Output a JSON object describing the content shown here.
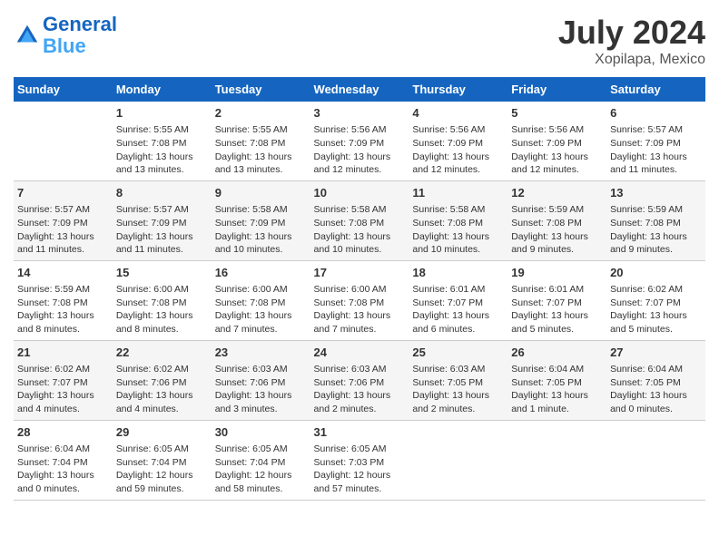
{
  "header": {
    "logo_line1": "General",
    "logo_line2": "Blue",
    "title": "July 2024",
    "subtitle": "Xopilapa, Mexico"
  },
  "columns": [
    "Sunday",
    "Monday",
    "Tuesday",
    "Wednesday",
    "Thursday",
    "Friday",
    "Saturday"
  ],
  "weeks": [
    [
      {
        "num": "",
        "info": ""
      },
      {
        "num": "1",
        "info": "Sunrise: 5:55 AM\nSunset: 7:08 PM\nDaylight: 13 hours\nand 13 minutes."
      },
      {
        "num": "2",
        "info": "Sunrise: 5:55 AM\nSunset: 7:08 PM\nDaylight: 13 hours\nand 13 minutes."
      },
      {
        "num": "3",
        "info": "Sunrise: 5:56 AM\nSunset: 7:09 PM\nDaylight: 13 hours\nand 12 minutes."
      },
      {
        "num": "4",
        "info": "Sunrise: 5:56 AM\nSunset: 7:09 PM\nDaylight: 13 hours\nand 12 minutes."
      },
      {
        "num": "5",
        "info": "Sunrise: 5:56 AM\nSunset: 7:09 PM\nDaylight: 13 hours\nand 12 minutes."
      },
      {
        "num": "6",
        "info": "Sunrise: 5:57 AM\nSunset: 7:09 PM\nDaylight: 13 hours\nand 11 minutes."
      }
    ],
    [
      {
        "num": "7",
        "info": "Sunrise: 5:57 AM\nSunset: 7:09 PM\nDaylight: 13 hours\nand 11 minutes."
      },
      {
        "num": "8",
        "info": "Sunrise: 5:57 AM\nSunset: 7:09 PM\nDaylight: 13 hours\nand 11 minutes."
      },
      {
        "num": "9",
        "info": "Sunrise: 5:58 AM\nSunset: 7:09 PM\nDaylight: 13 hours\nand 10 minutes."
      },
      {
        "num": "10",
        "info": "Sunrise: 5:58 AM\nSunset: 7:08 PM\nDaylight: 13 hours\nand 10 minutes."
      },
      {
        "num": "11",
        "info": "Sunrise: 5:58 AM\nSunset: 7:08 PM\nDaylight: 13 hours\nand 10 minutes."
      },
      {
        "num": "12",
        "info": "Sunrise: 5:59 AM\nSunset: 7:08 PM\nDaylight: 13 hours\nand 9 minutes."
      },
      {
        "num": "13",
        "info": "Sunrise: 5:59 AM\nSunset: 7:08 PM\nDaylight: 13 hours\nand 9 minutes."
      }
    ],
    [
      {
        "num": "14",
        "info": "Sunrise: 5:59 AM\nSunset: 7:08 PM\nDaylight: 13 hours\nand 8 minutes."
      },
      {
        "num": "15",
        "info": "Sunrise: 6:00 AM\nSunset: 7:08 PM\nDaylight: 13 hours\nand 8 minutes."
      },
      {
        "num": "16",
        "info": "Sunrise: 6:00 AM\nSunset: 7:08 PM\nDaylight: 13 hours\nand 7 minutes."
      },
      {
        "num": "17",
        "info": "Sunrise: 6:00 AM\nSunset: 7:08 PM\nDaylight: 13 hours\nand 7 minutes."
      },
      {
        "num": "18",
        "info": "Sunrise: 6:01 AM\nSunset: 7:07 PM\nDaylight: 13 hours\nand 6 minutes."
      },
      {
        "num": "19",
        "info": "Sunrise: 6:01 AM\nSunset: 7:07 PM\nDaylight: 13 hours\nand 5 minutes."
      },
      {
        "num": "20",
        "info": "Sunrise: 6:02 AM\nSunset: 7:07 PM\nDaylight: 13 hours\nand 5 minutes."
      }
    ],
    [
      {
        "num": "21",
        "info": "Sunrise: 6:02 AM\nSunset: 7:07 PM\nDaylight: 13 hours\nand 4 minutes."
      },
      {
        "num": "22",
        "info": "Sunrise: 6:02 AM\nSunset: 7:06 PM\nDaylight: 13 hours\nand 4 minutes."
      },
      {
        "num": "23",
        "info": "Sunrise: 6:03 AM\nSunset: 7:06 PM\nDaylight: 13 hours\nand 3 minutes."
      },
      {
        "num": "24",
        "info": "Sunrise: 6:03 AM\nSunset: 7:06 PM\nDaylight: 13 hours\nand 2 minutes."
      },
      {
        "num": "25",
        "info": "Sunrise: 6:03 AM\nSunset: 7:05 PM\nDaylight: 13 hours\nand 2 minutes."
      },
      {
        "num": "26",
        "info": "Sunrise: 6:04 AM\nSunset: 7:05 PM\nDaylight: 13 hours\nand 1 minute."
      },
      {
        "num": "27",
        "info": "Sunrise: 6:04 AM\nSunset: 7:05 PM\nDaylight: 13 hours\nand 0 minutes."
      }
    ],
    [
      {
        "num": "28",
        "info": "Sunrise: 6:04 AM\nSunset: 7:04 PM\nDaylight: 13 hours\nand 0 minutes."
      },
      {
        "num": "29",
        "info": "Sunrise: 6:05 AM\nSunset: 7:04 PM\nDaylight: 12 hours\nand 59 minutes."
      },
      {
        "num": "30",
        "info": "Sunrise: 6:05 AM\nSunset: 7:04 PM\nDaylight: 12 hours\nand 58 minutes."
      },
      {
        "num": "31",
        "info": "Sunrise: 6:05 AM\nSunset: 7:03 PM\nDaylight: 12 hours\nand 57 minutes."
      },
      {
        "num": "",
        "info": ""
      },
      {
        "num": "",
        "info": ""
      },
      {
        "num": "",
        "info": ""
      }
    ]
  ]
}
